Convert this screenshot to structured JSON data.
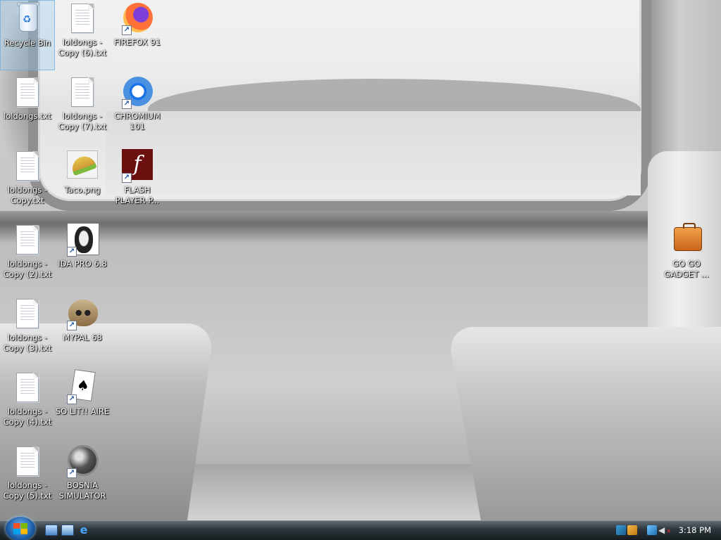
{
  "desktop": {
    "icons": [
      {
        "label": "Recycle Bin"
      },
      {
        "label": "loldongs.txt"
      },
      {
        "label": "loldongs - Copy.txt"
      },
      {
        "label": "loldongs - Copy (2).txt"
      },
      {
        "label": "loldongs - Copy (3).txt"
      },
      {
        "label": "loldongs - Copy (4).txt"
      },
      {
        "label": "loldongs - Copy (5).txt"
      },
      {
        "label": "loldongs - Copy (6).txt"
      },
      {
        "label": "loldongs - Copy (7).txt"
      },
      {
        "label": "Taco.png"
      },
      {
        "label": "IDA PRO 6.8"
      },
      {
        "label": "MYPAL 68"
      },
      {
        "label": "SO LIT!! AIRE"
      },
      {
        "label": "BOSNIA SIMULATOR"
      },
      {
        "label": "FIREFOX 91"
      },
      {
        "label": "CHROMIUM 101"
      },
      {
        "label": "FLASH PLAYER P..."
      },
      {
        "label": "GO GO GADGET ..."
      }
    ]
  },
  "taskbar": {
    "clock": "3:18 PM"
  },
  "icons": {
    "recycle_bin": "recycle-bin-icon",
    "text_file": "text-file-icon",
    "image_file": "taco-image-icon",
    "firefox": "firefox-icon",
    "chromium": "chromium-icon",
    "flash": "flash-player-icon",
    "ida": "ida-pro-icon",
    "mypal": "mypal-raccoon-icon",
    "solitaire": "solitaire-cards-icon",
    "minesweeper": "mine-icon",
    "gadget": "briefcase-icon",
    "shortcut": "shortcut-arrow-icon"
  },
  "colors": {
    "taskbar": "#2c353b",
    "selection": "#96c8eb",
    "label_text": "#ffffff"
  }
}
